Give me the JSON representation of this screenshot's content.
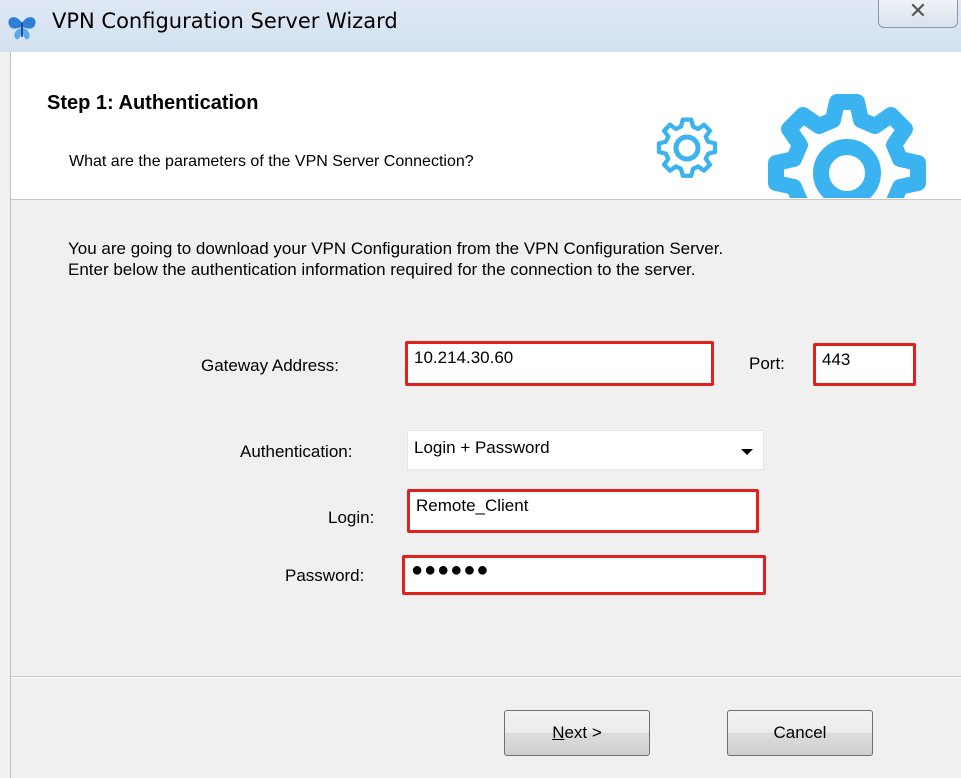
{
  "window": {
    "title": "VPN Configuration Server Wizard",
    "app_icon": "butterfly-icon",
    "close_icon": "close-x-icon"
  },
  "header": {
    "step_title": "Step 1: Authentication",
    "subtitle": "What are the parameters of the VPN Server Connection?",
    "decoration_icon": "gears-icon",
    "gear_color": "#3ab3f0"
  },
  "intro": {
    "line1": "You are going to download your VPN Configuration from the VPN Configuration Server.",
    "line2": "Enter below the authentication information required for the connection to the server."
  },
  "form": {
    "gateway_label": "Gateway Address:",
    "gateway_value": "10.214.30.60",
    "port_label": "Port:",
    "port_value": "443",
    "auth_label": "Authentication:",
    "auth_value": "Login + Password",
    "login_label": "Login:",
    "login_value": "Remote_Client",
    "password_label": "Password:",
    "password_value": "●●●●●●"
  },
  "buttons": {
    "next_mnemonic": "N",
    "next_rest": "ext >",
    "cancel": "Cancel"
  },
  "colors": {
    "highlight": "#e3201b",
    "header_bg": "#ffffff",
    "dialog_bg": "#f0f0f0"
  }
}
